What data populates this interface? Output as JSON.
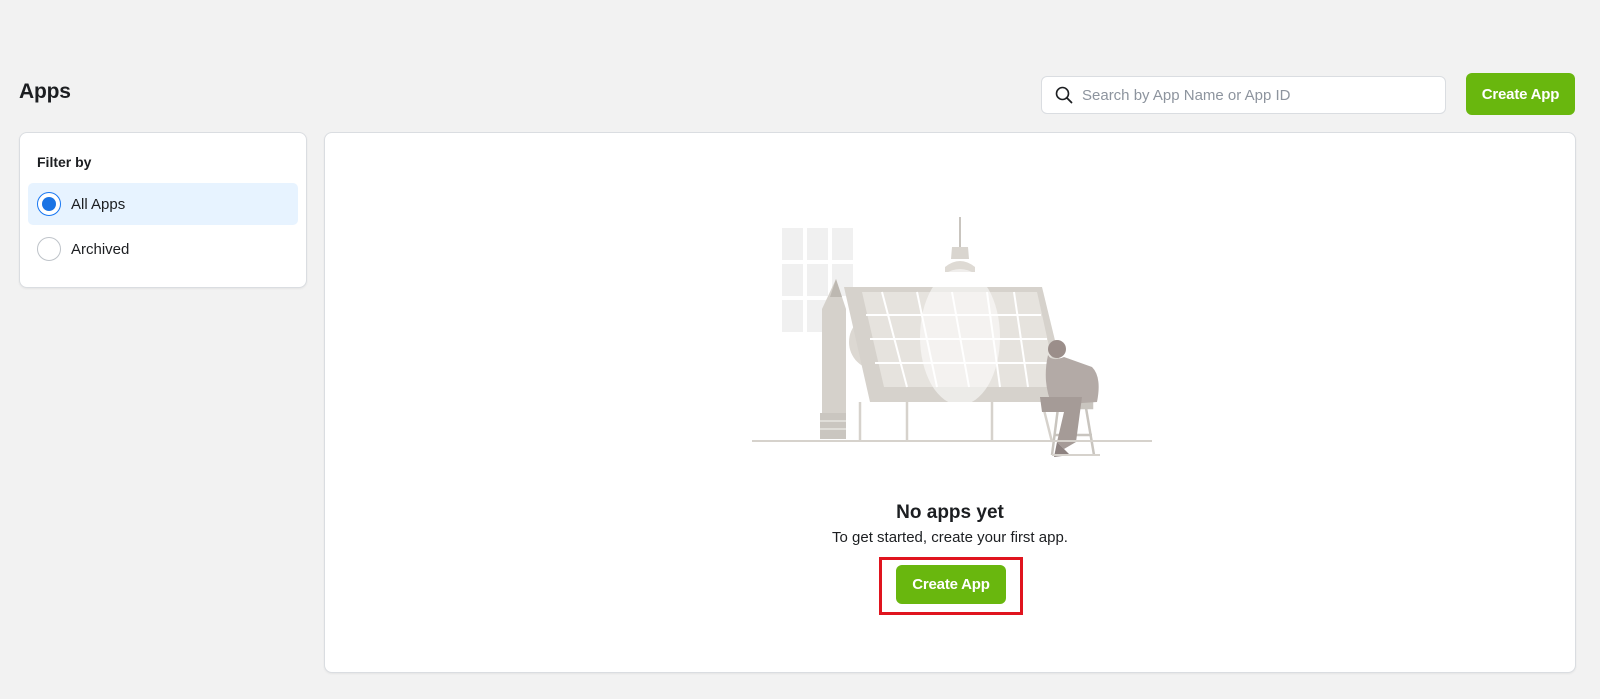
{
  "header": {
    "title": "Apps",
    "search": {
      "placeholder": "Search by App Name or App ID",
      "value": "",
      "icon": "search-icon"
    },
    "create_button_label": "Create App"
  },
  "filter": {
    "title": "Filter by",
    "options": [
      {
        "label": "All Apps",
        "selected": true
      },
      {
        "label": "Archived",
        "selected": false
      }
    ]
  },
  "empty_state": {
    "title": "No apps yet",
    "subtitle": "To get started, create your first app.",
    "create_button_label": "Create App"
  },
  "colors": {
    "background": "#f2f2f2",
    "primary_green": "#69b70e",
    "selected_bg": "#e7f3ff",
    "radio_blue": "#1b74e4",
    "highlight_red": "#e0141e"
  }
}
